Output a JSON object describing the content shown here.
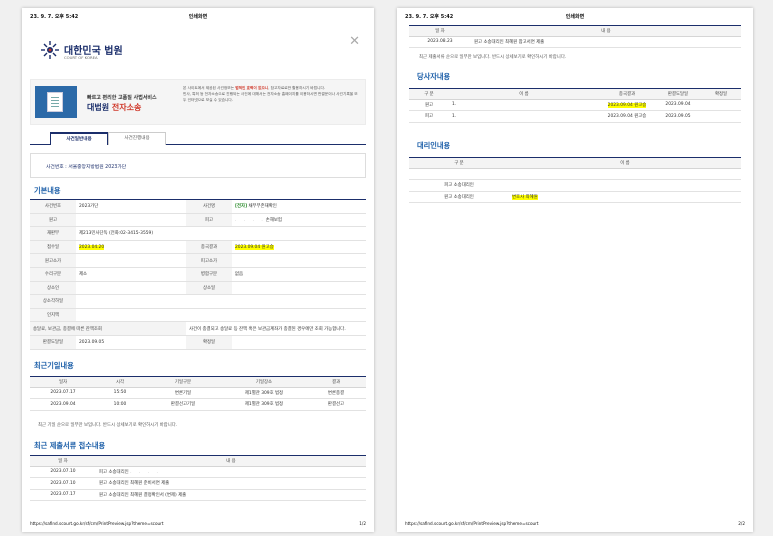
{
  "header": {
    "datetime": "23. 9. 7. 오후 5:42",
    "title": "인쇄화면"
  },
  "footer": {
    "url": "https://safind.scourt.go.kr/sf/cm/PrintPreview.jsp?theme=scourt",
    "page1": "1/2",
    "page2": "2/2"
  },
  "logo": {
    "name": "대한민국 법원",
    "sub": "COURT OF KOREA"
  },
  "banner": {
    "line1": "빠르고 편리한 고품질 사법서비스",
    "brand": "대법원",
    "brand_red": "전자소송",
    "desc_pre": "본 사이트에서 제공된 사건정보는 ",
    "desc_hl": "법적인 효력이 없으니",
    "desc_post": ", 참고자료로만 활용하시기 바랍니다.",
    "desc2": "민사, 특허 등 전자소송으로 진행되는 사건에 대해서는 전자소송 홈페이지를 이용하시면 판결문이나 사건기록을 모두 인터넷으로 보실 수 있습니다."
  },
  "tabs": {
    "tab1": "사건일반내용",
    "tab2": "사건진행내용"
  },
  "case_number": "사건번호 : 서울중앙지방법원 2023가단",
  "sections": {
    "basic": "기본내용",
    "hearing": "최근기일내용",
    "docs": "최근 제출서류 접수내용",
    "party": "당사자내용",
    "agent": "대리인내용"
  },
  "basic": {
    "case_no_label": "사건번호",
    "case_no": "2023가단",
    "case_name_label": "사건명",
    "case_name_tag": "[전자]",
    "case_name": "채무부존재확인",
    "plaintiff_label": "원고",
    "plaintiff": "",
    "defendant_label": "피고",
    "defendant": "손해보험",
    "dept_label": "재판부",
    "dept": "제213민사단독 (전화:02-3415-3559)",
    "received_label": "접수일",
    "received": "2023.04.20",
    "result_label": "종국결과",
    "result": "2023.09.04 원고승",
    "plaintiff_value_label": "원고소가",
    "plaintiff_value": "",
    "defendant_value_label": "피고소가",
    "defendant_value": "",
    "stamp_return_label": "수리구분",
    "stamp_return": "제소",
    "merge_label": "병합구분",
    "merge": "없음",
    "appeal_date_label": "상소인",
    "appeal_date": "",
    "appeal_day_label": "상소일",
    "appeal_day": "",
    "appeal_reject_label": "상소각하일",
    "appeal_reject": "",
    "preservation_label": "인지액",
    "preservation": "",
    "deposit_label": "송달료, 보관금, 종결에 따른 잔액조회",
    "deposit": "사건이 종결되고 송달료 등 잔액 혹은 보관금계좌가 종결된 경우에만 조회 가능합니다.",
    "final_date_label": "판결도달일",
    "final_date": "2023.09.05",
    "confirm_label": "확정일",
    "confirm": ""
  },
  "hearing": {
    "headers": [
      "일자",
      "시각",
      "기일구분",
      "기일장소",
      "결과"
    ],
    "rows": [
      [
        "2023.07.17",
        "15:50",
        "변론기일",
        "제1별관 309호 법정",
        "변론종결"
      ],
      [
        "2023.09.04",
        "10:00",
        "판결선고기일",
        "제1별관 309호 법정",
        "판결선고"
      ]
    ],
    "note": "최근 기일 순으로 일부만 보입니다. 반드시 상세보기로 확인하시기 바랍니다."
  },
  "docs": {
    "headers": [
      "일 자",
      "내 용"
    ],
    "rows": [
      [
        "2023.07.10",
        "피고 소송대리인 "
      ],
      [
        "2023.07.10",
        "원고 소송대리인 최혜원 준비서면 제출"
      ],
      [
        "2023.07.17",
        "원고 소송대리인 최혜원 결정확인서 (변제) 제출"
      ],
      [
        "2023.08.23",
        "원고 소송대리인 최혜원 참고서면 제출"
      ]
    ],
    "note": "최근 제출서류 순으로 일부만 보입니다. 반드시 상세보기로 확인하시기 바랍니다."
  },
  "party": {
    "headers": [
      "구 분",
      "이 름",
      "종국결과",
      "판결도달일",
      "확정일"
    ],
    "rows": [
      [
        "원고",
        "1.",
        "2023.09.04 원고승",
        "2023.09.04",
        ""
      ],
      [
        "피고",
        "1.",
        "2023.09.04 원고승",
        "2023.09.05",
        ""
      ]
    ]
  },
  "agent": {
    "headers": [
      "구 분",
      "이 름"
    ],
    "rows": [
      [
        "",
        ""
      ],
      [
        "피고 소송대리인",
        ""
      ],
      [
        "원고 소송대리인",
        "변호사 최혜원"
      ]
    ]
  }
}
